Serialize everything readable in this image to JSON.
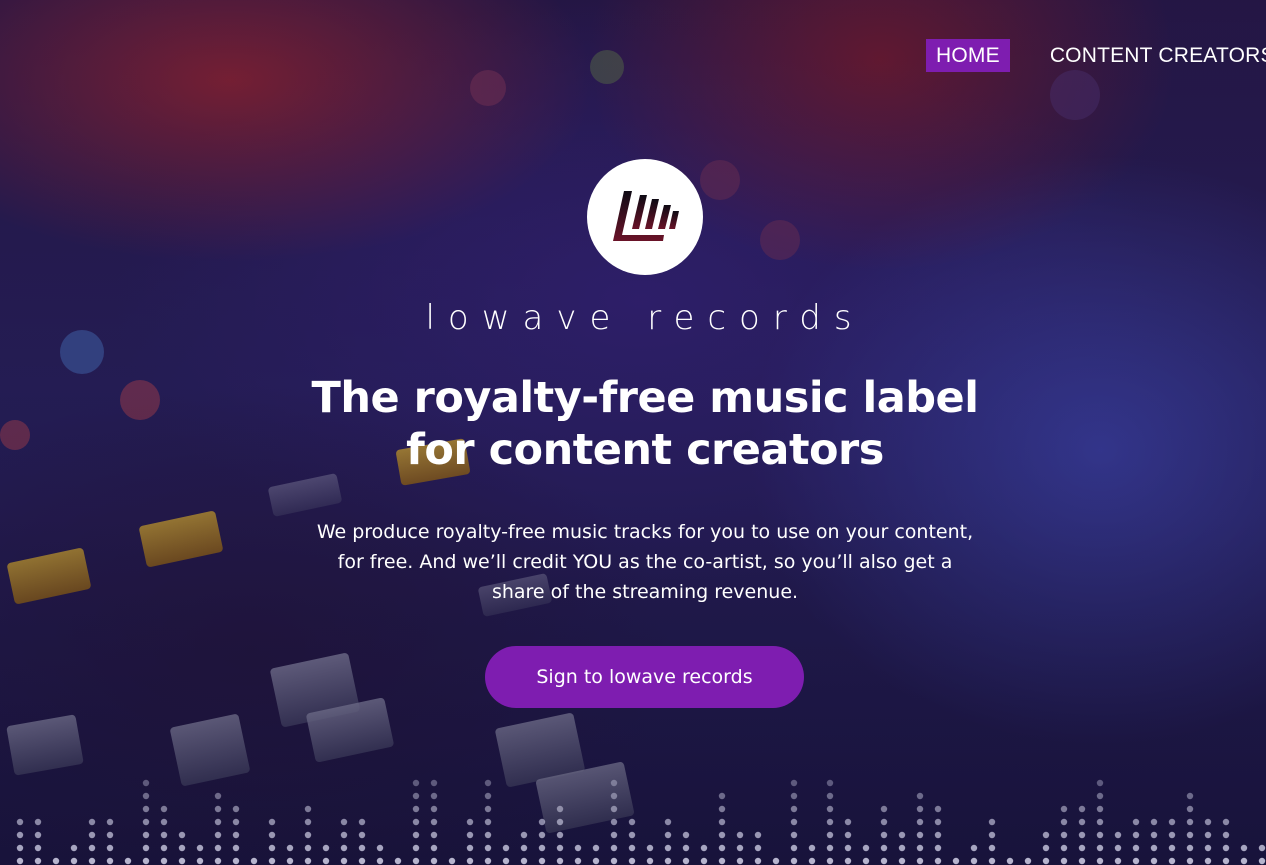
{
  "nav": {
    "items": [
      {
        "label": "HOME",
        "active": true
      },
      {
        "label": "CONTENT CREATORS",
        "active": false
      }
    ]
  },
  "logo": {
    "icon": "lowave-bars-icon"
  },
  "brand": {
    "name": "lowave records"
  },
  "hero": {
    "headline_line1": "The royalty-free music label",
    "headline_line2": "for content creators",
    "subtext_line1": "We produce royalty-free music tracks for you to use on your content,",
    "subtext_line2": "for free. And we’ll credit YOU as the co-artist, so you’ll also get a",
    "subtext_line3": "share of the streaming revenue.",
    "cta_label": "Sign to lowave records"
  },
  "colors": {
    "accent": "#7e1db0",
    "text": "#ffffff"
  }
}
